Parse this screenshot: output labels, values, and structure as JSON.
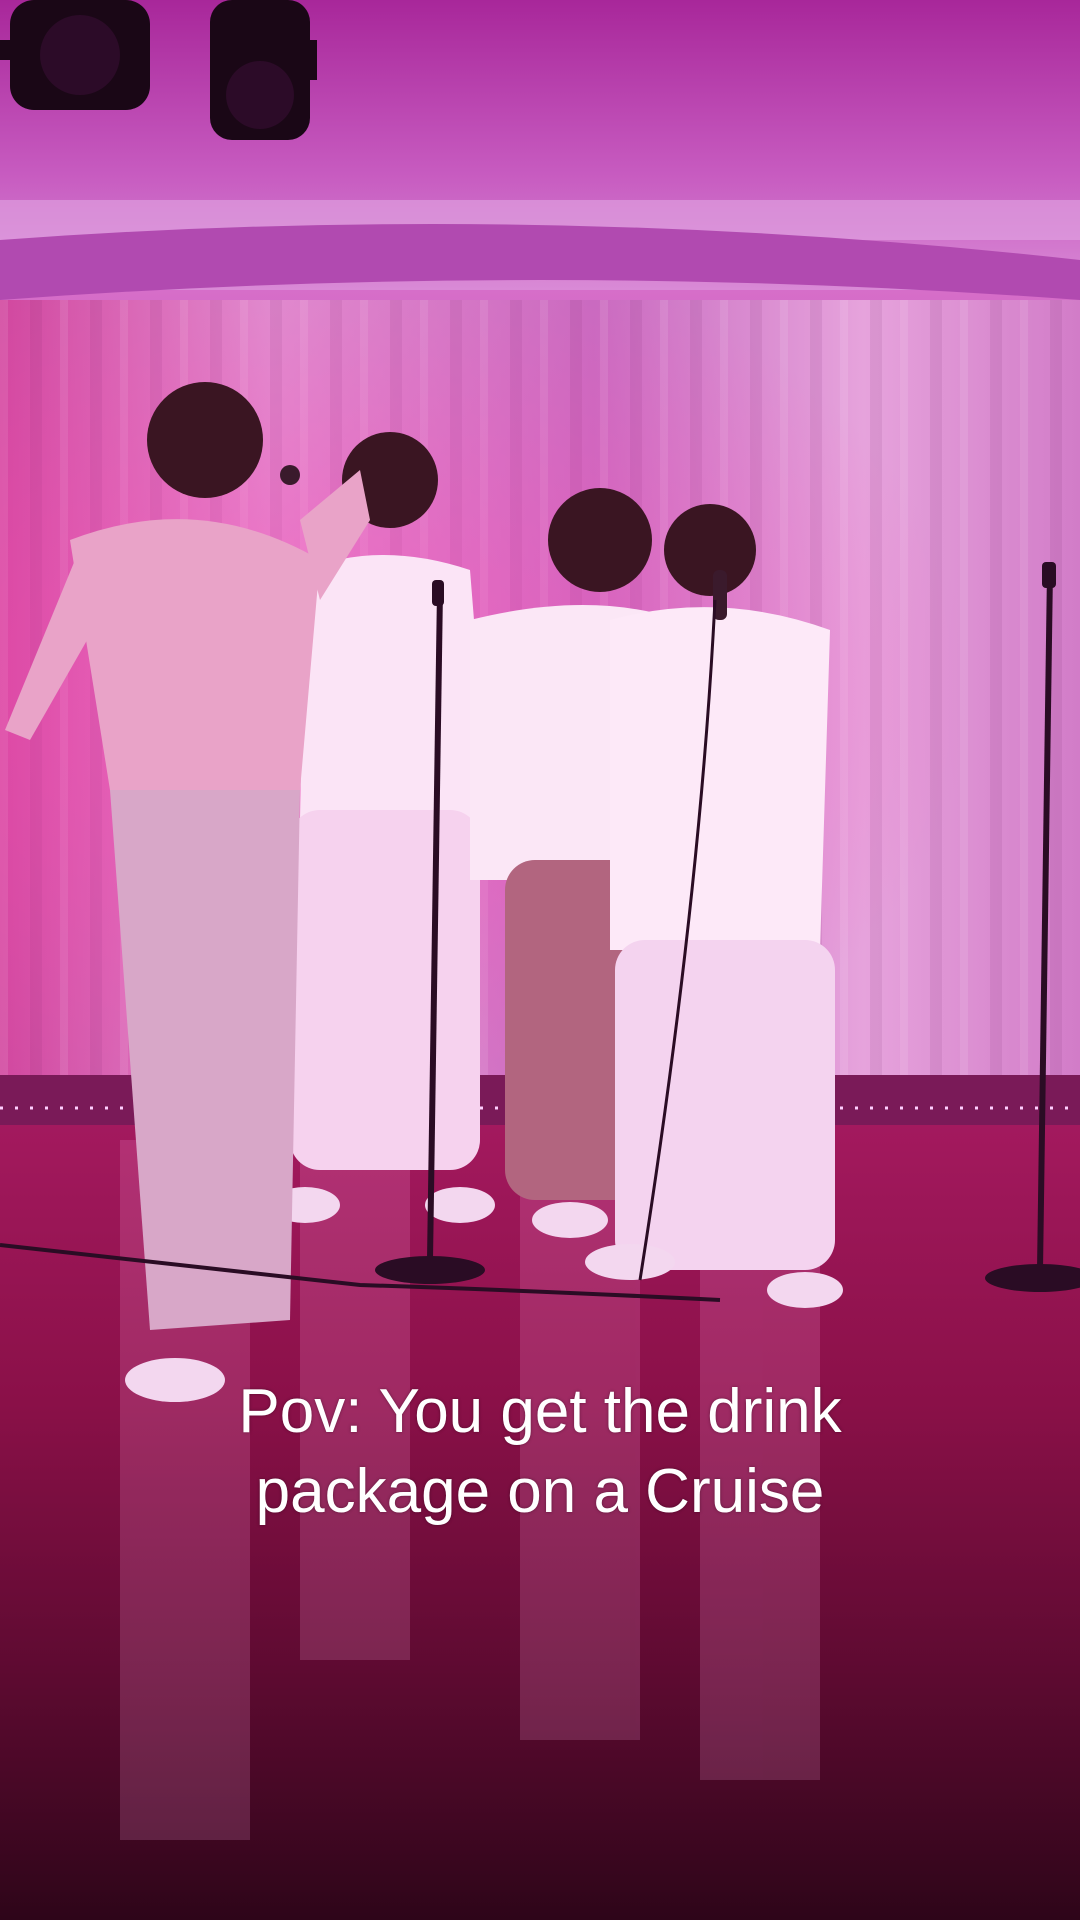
{
  "video": {
    "caption_lines": [
      "Pov: You get the drink",
      "package on a Cruise"
    ]
  },
  "colors": {
    "ceiling": "#c75bc0",
    "curtain": "#d98ad0",
    "stage_light": "#ff6fd8",
    "floor": "#8a1048",
    "caption_text": "#ffffff"
  },
  "scene_elements": {
    "performers_count": 4,
    "mic_stands_count": 2,
    "stage_lights_count": 2
  }
}
